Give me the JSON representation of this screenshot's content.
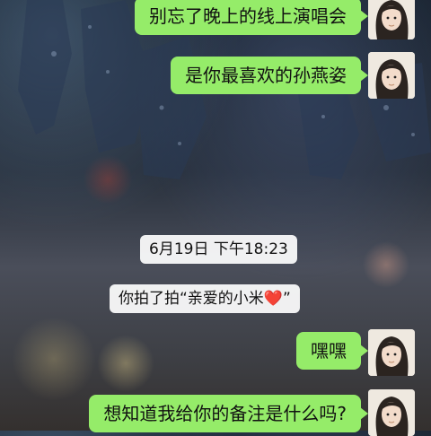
{
  "messages": [
    {
      "text": "别忘了晚上的线上演唱会"
    },
    {
      "text": "是你最喜欢的孙燕姿"
    },
    {
      "text": "嘿嘿"
    },
    {
      "text": "想知道我给你的备注是什么吗?"
    }
  ],
  "timestamp": "6月19日  下午18:23",
  "pat_notice": {
    "text": "你拍了拍“亲爱的小米",
    "emoji": "❤️",
    "close_quote": "”"
  },
  "icons": {
    "avatar": "avatar-girl-illustration",
    "heart": "heart-icon"
  },
  "colors": {
    "bubble": "#95ec69",
    "heart": "#d9262b"
  }
}
